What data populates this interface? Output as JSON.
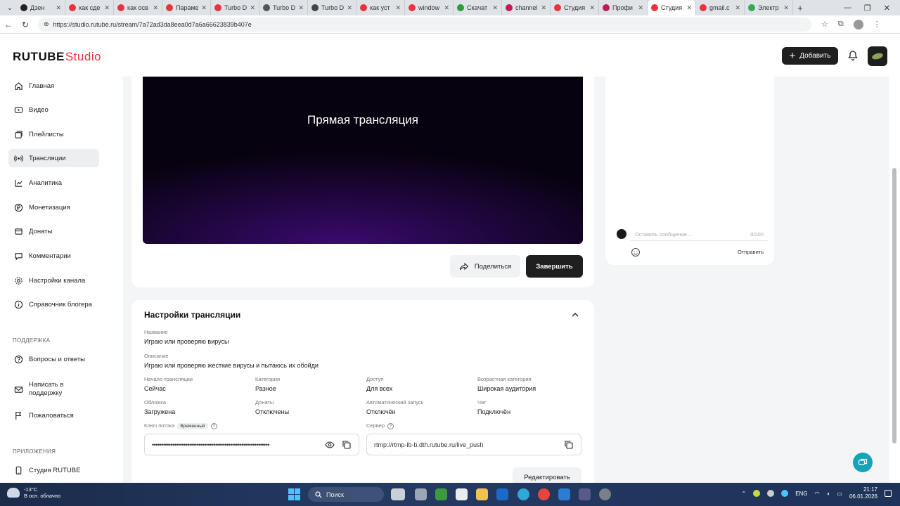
{
  "browser": {
    "tabs": [
      {
        "title": "Дзен",
        "color": "#222"
      },
      {
        "title": "как сде",
        "color": "#e8333c"
      },
      {
        "title": "как осв",
        "color": "#e8333c"
      },
      {
        "title": "Параме",
        "color": "#e8333c"
      },
      {
        "title": "Turbo D",
        "color": "#e8333c"
      },
      {
        "title": "Turbo D",
        "color": "#555"
      },
      {
        "title": "Turbo D",
        "color": "#444"
      },
      {
        "title": "как уст",
        "color": "#e8333c"
      },
      {
        "title": "window",
        "color": "#e8333c"
      },
      {
        "title": "Скачат",
        "color": "#2c9c3c"
      },
      {
        "title": "channel",
        "color": "#c2185b"
      },
      {
        "title": "Студия",
        "color": "#e8333c"
      },
      {
        "title": "Профи",
        "color": "#c2185b"
      },
      {
        "title": "Студия",
        "color": "#e8333c"
      },
      {
        "title": "gmail.c",
        "color": "#e8333c"
      },
      {
        "title": "Электр",
        "color": "#34a853"
      }
    ],
    "url": "https://studio.rutube.ru/stream/7a72ad3da8eea0d7a6a66623839b407e"
  },
  "header": {
    "logo_main": "RUTUBE",
    "logo_sub": "Studio",
    "add_label": "Добавить"
  },
  "sidebar": {
    "items": [
      {
        "label": "Главная"
      },
      {
        "label": "Видео"
      },
      {
        "label": "Плейлисты"
      },
      {
        "label": "Трансляции"
      },
      {
        "label": "Аналитика"
      },
      {
        "label": "Монетизация"
      },
      {
        "label": "Донаты"
      },
      {
        "label": "Комментарии"
      },
      {
        "label": "Настройки канала"
      },
      {
        "label": "Справочник блогера"
      }
    ],
    "support_title": "ПОДДЕРЖКА",
    "support_items": [
      {
        "label": "Вопросы и ответы"
      },
      {
        "label": "Написать в поддержку"
      },
      {
        "label": "Пожаловаться"
      }
    ],
    "apps_title": "ПРИЛОЖЕНИЯ",
    "apps_items": [
      {
        "label": "Студия RUTUBE"
      }
    ]
  },
  "player": {
    "title": "Прямая трансляция",
    "share_label": "Поделиться",
    "finish_label": "Завершить"
  },
  "chat": {
    "placeholder": "Оставить сообщение...",
    "counter": "0/200",
    "send_label": "Отправить"
  },
  "settings": {
    "title": "Настройки трансляции",
    "name_label": "Название",
    "name_value": "Играю или проверяю вирусы",
    "desc_label": "Описание",
    "desc_value": "Играю или проверяю жесткие вирусы и пытаюсь их обойди",
    "grid": [
      {
        "label": "Начало трансляции",
        "value": "Сейчас"
      },
      {
        "label": "Категория",
        "value": "Разное"
      },
      {
        "label": "Доступ",
        "value": "Для всех"
      },
      {
        "label": "Возрастная категория",
        "value": "Широкая аудитория"
      },
      {
        "label": "Обложка",
        "value": "Загружена"
      },
      {
        "label": "Донаты",
        "value": "Отключены"
      },
      {
        "label": "Автоматический запуск",
        "value": "Отключён"
      },
      {
        "label": "Чат",
        "value": "Подключён"
      }
    ],
    "key_label": "Ключ потока",
    "key_badge": "Временный",
    "key_value": "•••••••••••••••••••••••••••••••••••••••••••••••••••••••••••••••",
    "server_label": "Сервер",
    "server_value": "rtmp://rtmp-lb-b.dth.rutube.ru/live_push",
    "edit_label": "Редактировать"
  },
  "taskbar": {
    "temp": "-13°C",
    "weather": "В осн. облачно",
    "search": "Поиск",
    "lang": "ENG",
    "time": "21:17",
    "date": "06.01.2026"
  }
}
